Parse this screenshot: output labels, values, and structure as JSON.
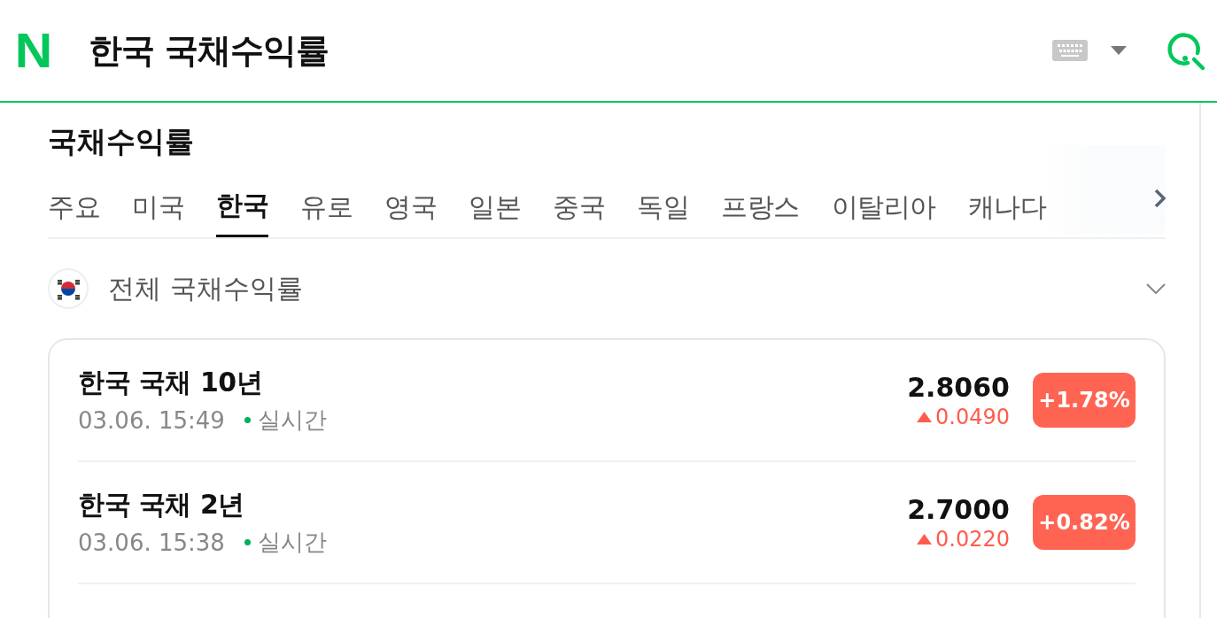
{
  "header": {
    "logo": "N",
    "title": "한국 국채수익률"
  },
  "section": {
    "title": "국채수익률"
  },
  "tabs": [
    {
      "label": "주요",
      "selected": false
    },
    {
      "label": "미국",
      "selected": false
    },
    {
      "label": "한국",
      "selected": true
    },
    {
      "label": "유로",
      "selected": false
    },
    {
      "label": "영국",
      "selected": false
    },
    {
      "label": "일본",
      "selected": false
    },
    {
      "label": "중국",
      "selected": false
    },
    {
      "label": "독일",
      "selected": false
    },
    {
      "label": "프랑스",
      "selected": false
    },
    {
      "label": "이탈리아",
      "selected": false
    },
    {
      "label": "캐나다",
      "selected": false
    }
  ],
  "filter": {
    "label": "전체 국채수익률",
    "expanded": false
  },
  "bonds": [
    {
      "name": "한국 국채 10년",
      "time": "03.06. 15:49",
      "status": "실시간",
      "value": "2.8060",
      "change": "0.0490",
      "rate": "+1.78%",
      "kind": "up"
    },
    {
      "name": "한국 국채 2년",
      "time": "03.06. 15:38",
      "status": "실시간",
      "value": "2.7000",
      "change": "0.0220",
      "rate": "+0.82%",
      "kind": "up"
    }
  ]
}
